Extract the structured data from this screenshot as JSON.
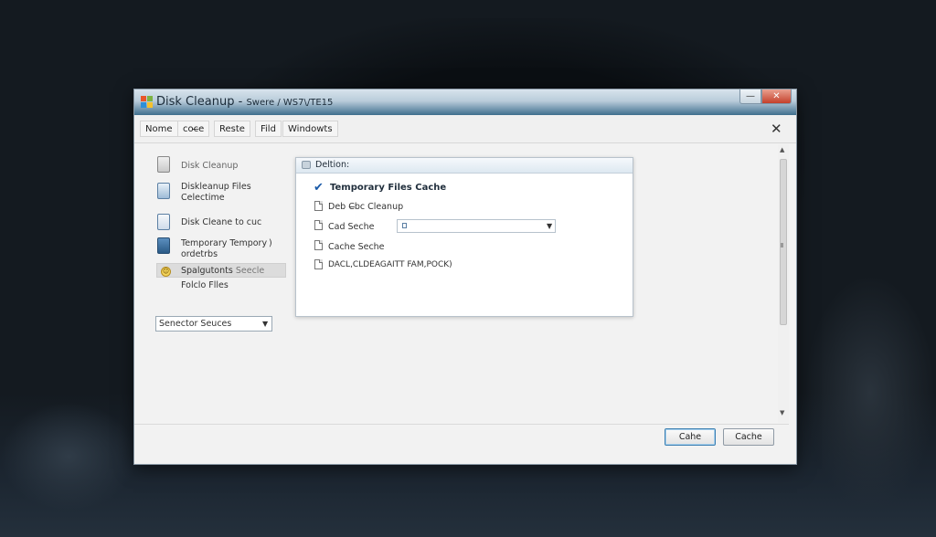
{
  "window": {
    "title": "Disk Cleanup",
    "title_separator": "-",
    "subtitle": "Swere / WS7\\/TE15"
  },
  "menubar": {
    "items": [
      "Nome",
      "coc̶e",
      "Reste",
      "Fild",
      "Windowts"
    ],
    "close_glyph": "✕"
  },
  "left_panel": {
    "items": [
      {
        "label": "Disk Cleanup"
      },
      {
        "label": "Diskleanup Files",
        "label2": "Celectime"
      },
      {
        "label": "Disk Cleane to cuc"
      },
      {
        "label": "Temporary Tempory",
        "suffix": " )",
        "label2": "ordetrbs"
      },
      {
        "label": "Spalgutonts",
        "suffix": "Seecle"
      },
      {
        "label": "Folclo Flles"
      }
    ],
    "dropdown": {
      "value": "Senector Seuces"
    }
  },
  "panel": {
    "header": "Deltion:",
    "selected": "Temporary Files Cache",
    "items": [
      "Deb C̶bc Cleanup",
      "Cad Seche",
      "Cache Seche",
      "DACL,CLDEAGAITT FAM,POCK)"
    ],
    "combo_value": ""
  },
  "buttons": {
    "ok_label": "Cahe",
    "cancel_label": "Cache"
  },
  "colors": {
    "titlebar_accent": "#3f6f8e",
    "close_button": "#c4402b",
    "check": "#1a5aa8"
  }
}
